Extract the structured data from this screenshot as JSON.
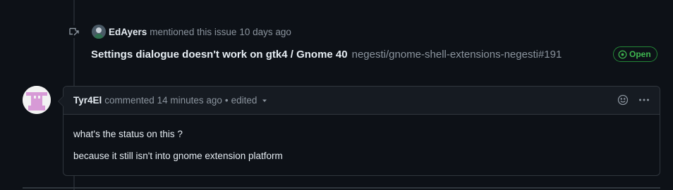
{
  "timeline_event": {
    "actor": "EdAyers",
    "action": "mentioned this issue",
    "time": "10 days ago",
    "issue_title": "Settings dialogue doesn't work on gtk4 / Gnome 40",
    "issue_ref": "negesti/gnome-shell-extensions-negesti#191",
    "status": "Open"
  },
  "comment": {
    "author": "Tyr4El",
    "meta": "commented 14 minutes ago",
    "separator": "•",
    "edited": "edited",
    "body": [
      "what's the status on this ?",
      "because it still isn't into gnome extension platform"
    ]
  },
  "icons": {
    "event": "cross-reference-icon",
    "status": "issue-open-icon",
    "reaction": "smiley-icon",
    "menu": "kebab-horizontal-icon",
    "edited_menu": "triangle-down-icon"
  },
  "colors": {
    "background": "#0d1117",
    "header": "#161b22",
    "border": "#30363d",
    "open_green": "#3fb950",
    "muted": "#8b949e"
  }
}
